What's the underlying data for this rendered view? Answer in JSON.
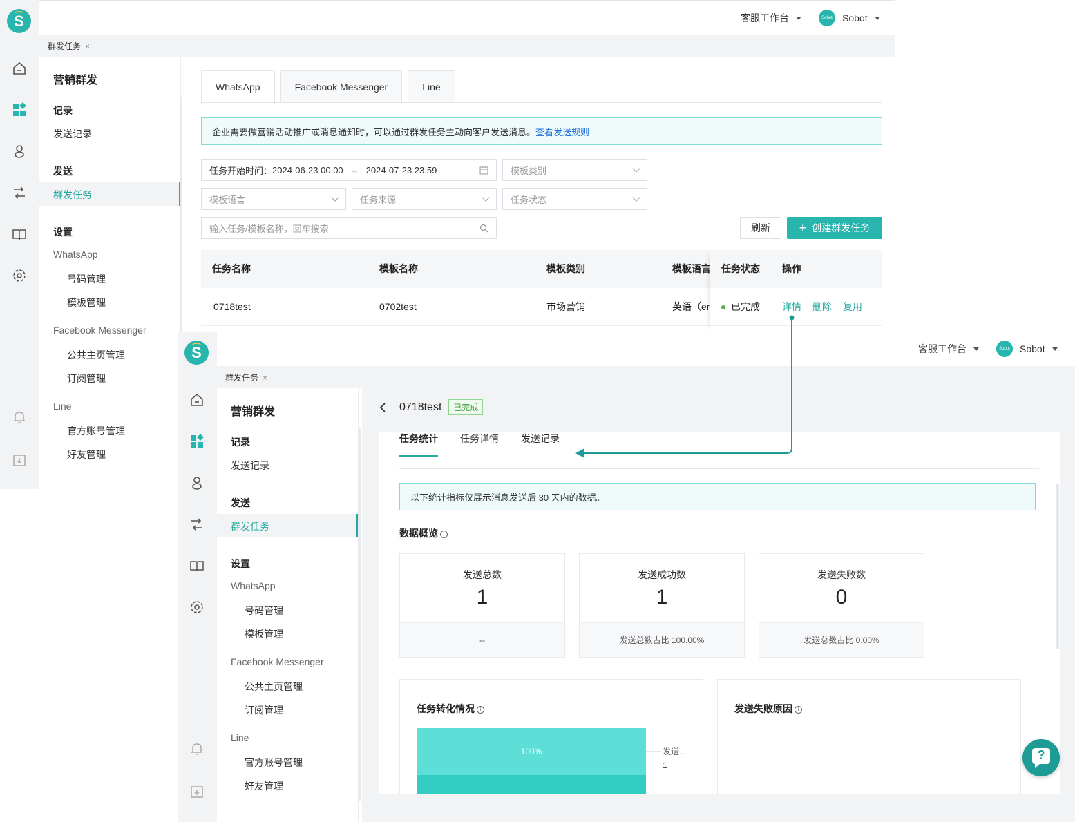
{
  "topbar": {
    "workspace": "客服工作台",
    "user": "Sobot",
    "avatar_text": "Sobot"
  },
  "logo": "S",
  "page_tab": {
    "label": "群发任务",
    "close": "×"
  },
  "menu": {
    "title": "营销群发",
    "group_record": "记录",
    "send_record": "发送记录",
    "group_send": "发送",
    "mass_task": "群发任务",
    "group_settings": "设置",
    "whatsapp": "WhatsApp",
    "number_mgmt": "号码管理",
    "template_mgmt": "模板管理",
    "fb_messenger": "Facebook Messenger",
    "public_page_mgmt": "公共主页管理",
    "subscribe_mgmt": "订阅管理",
    "line": "Line",
    "official_account_mgmt": "官方账号管理",
    "friend_mgmt": "好友管理"
  },
  "list": {
    "tabs": [
      "WhatsApp",
      "Facebook Messenger",
      "Line"
    ],
    "notice": "企业需要做营销活动推广或消息通知时，可以通过群发任务主动向客户发送消息。",
    "notice_link": "查看发送规则",
    "date_label": "任务开始时间：",
    "date_start": "2024-06-23 00:00",
    "date_arrow": "→",
    "date_end": "2024-07-23 23:59",
    "ph_template_category": "模板类别",
    "ph_template_language": "模板语言",
    "ph_task_source": "任务来源",
    "ph_task_status": "任务状态",
    "ph_search": "输入任务/模板名称，回车搜索",
    "refresh": "刷新",
    "create": "创建群发任务",
    "columns": [
      "任务名称",
      "模板名称",
      "模板类别",
      "模板语言",
      "任务状态",
      "操作"
    ],
    "row": {
      "task": "0718test",
      "template": "0702test",
      "category": "市场营销",
      "language": "英语（en",
      "status": "已完成",
      "detail": "详情",
      "delete": "删除",
      "reuse": "复用"
    }
  },
  "detail": {
    "title": "0718test",
    "status_badge": "已完成",
    "tabs": [
      "任务统计",
      "任务详情",
      "发送记录"
    ],
    "notice": "以下统计指标仅展示消息发送后 30 天内的数据。",
    "overview": "数据概览",
    "cards": [
      {
        "title": "发送总数",
        "value": "1",
        "footer": "--"
      },
      {
        "title": "发送成功数",
        "value": "1",
        "footer": "发送总数占比  100.00%"
      },
      {
        "title": "发送失败数",
        "value": "0",
        "footer": "发送总数占比  0.00%"
      }
    ],
    "conversion_title": "任务转化情况",
    "fail_reason_title": "发送失败原因",
    "funnel_pct": "100%",
    "funnel_label": "发送...",
    "funnel_value": "1"
  },
  "help_icon": "?",
  "chart_data": {
    "type": "bar",
    "title": "任务转化情况",
    "categories": [
      "发送..."
    ],
    "values": [
      1
    ],
    "percent": [
      100
    ]
  }
}
